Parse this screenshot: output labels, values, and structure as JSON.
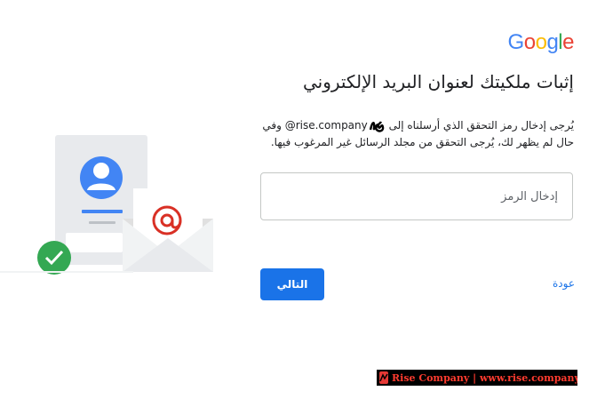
{
  "logo": {
    "letters": [
      "G",
      "o",
      "o",
      "g",
      "l",
      "e"
    ],
    "colors": [
      "#4285f4",
      "#ea4335",
      "#fbbc05",
      "#4285f4",
      "#34a853",
      "#ea4335"
    ]
  },
  "title": "إثبات ملكيتك لعنوان البريد الإلكتروني",
  "description": {
    "before_email": "يُرجى إدخال رمز التحقق الذي أرسلناه إلى",
    "email_domain": "@rise.company",
    "after_email": "وفي حال لم يظهر لك، يُرجى التحقق من مجلد الرسائل غير المرغوب فيها."
  },
  "code_input": {
    "placeholder": "إدخال الرمز",
    "value": ""
  },
  "next_button": {
    "label": "التالي"
  },
  "back_link": {
    "label": "عودة"
  },
  "footer_banner": {
    "text": "Rise Company | www.rise.company"
  },
  "colors": {
    "primary": "#1a73e8",
    "check_green": "#34a853",
    "avatar_blue": "#4285f4",
    "at_red": "#d93025"
  },
  "icons": [
    "person-avatar-icon",
    "envelope-icon",
    "at-sign-icon",
    "check-circle-icon"
  ]
}
